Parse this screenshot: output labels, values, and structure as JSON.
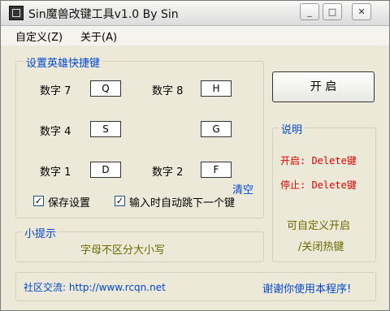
{
  "window": {
    "title": "Sin魔兽改键工具v1.0    By  Sin",
    "icons": {
      "app": "app-icon",
      "minimize": "minimize-icon",
      "maximize": "maximize-icon",
      "close": "close-icon"
    },
    "menu": [
      "自定义(Z)",
      "关于(A)"
    ]
  },
  "hotkeys_group": {
    "title": "设置英雄快捷键",
    "rows": [
      {
        "label": "数字 7",
        "value": "Q"
      },
      {
        "label": "数字 8",
        "value": "H"
      },
      {
        "label": "数字 4",
        "value": "S"
      },
      {
        "label": "",
        "value": "G"
      },
      {
        "label": "数字 1",
        "value": "D"
      },
      {
        "label": "数字 2",
        "value": "F"
      }
    ],
    "clear": "清空",
    "options": [
      {
        "label": "保存设置",
        "checked": true
      },
      {
        "label": "输入时自动跳下一个键",
        "checked": true
      }
    ]
  },
  "start_button": {
    "label": "开 启"
  },
  "explain_group": {
    "title": "说明",
    "on_line": "开启: Delete键",
    "off_line": "停止: Delete键",
    "custom_line1": "可自定义开启",
    "custom_line2": "/关闭热键"
  },
  "tips_group": {
    "title": "小提示",
    "text": "字母不区分大小写"
  },
  "footer": {
    "community": "社区交流: http://www.rcqn.net",
    "thanks": "谢谢你使用本程序!"
  }
}
